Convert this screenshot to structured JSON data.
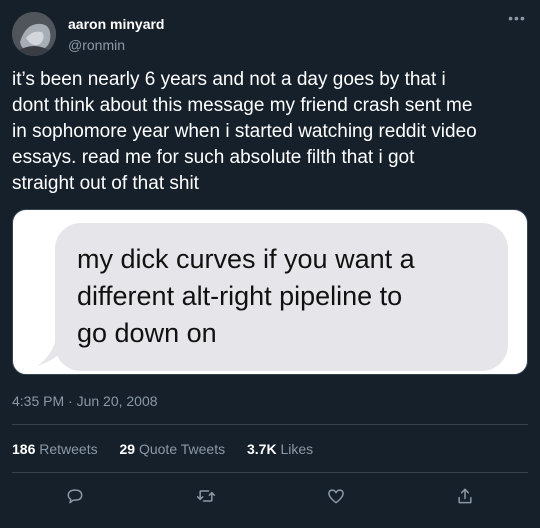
{
  "author": {
    "display_name": "aaron minyard",
    "handle": "@ronmin"
  },
  "more_menu": "•••",
  "tweet": {
    "text": "it’s been nearly 6 years and not a day goes by that i\ndont think about this message my friend crash sent me\nin sophomore year when i started watching reddit video\nessays. read me for such absolute filth that i got\nstraight out of that shit",
    "image_message": "my dick curves if you want a\ndifferent alt-right pipeline to\ngo down on",
    "timestamp": "4:35 PM · Jun 20, 2008"
  },
  "stats": {
    "retweets_count": "186",
    "retweets_label": "Retweets",
    "quote_count": "29",
    "quote_label": "Quote Tweets",
    "likes_count": "3.7K",
    "likes_label": "Likes"
  },
  "actions": {
    "reply_icon": "reply-icon",
    "retweet_icon": "retweet-icon",
    "like_icon": "like-icon",
    "share_icon": "share-icon"
  },
  "colors": {
    "background": "#15202b",
    "secondary_text": "#8b98a5",
    "divider": "#38444d",
    "bubble": "#e5e5ea"
  }
}
